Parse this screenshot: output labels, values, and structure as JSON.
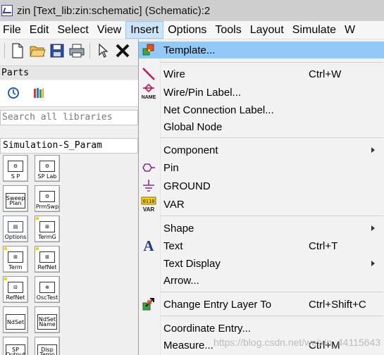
{
  "window": {
    "title": "zin [Text_lib:zin:schematic] (Schematic):2"
  },
  "menubar": {
    "items": [
      "File",
      "Edit",
      "Select",
      "View",
      "Insert",
      "Options",
      "Tools",
      "Layout",
      "Simulate",
      "W"
    ],
    "active": "Insert"
  },
  "toolbar": {
    "icons": [
      "new-document-icon",
      "open-folder-icon",
      "save-icon",
      "print-icon",
      "pointer-icon",
      "delete-x-icon"
    ]
  },
  "parts": {
    "header": "Parts",
    "search_placeholder": "Search all libraries",
    "library": "Simulation-S_Param",
    "palette": [
      {
        "top": "",
        "label": "S P"
      },
      {
        "top": "",
        "label": "SP Lab"
      },
      {
        "top": "Sweep Plan",
        "label": ""
      },
      {
        "top": "",
        "label": "PrmSwp"
      },
      {
        "top": "",
        "label": "Options"
      },
      {
        "top": "",
        "label": "TermG"
      },
      {
        "top": "",
        "label": "Term"
      },
      {
        "top": "",
        "label": "RefNet"
      },
      {
        "top": "",
        "label": "RefNet"
      },
      {
        "top": "",
        "label": "OscTest"
      },
      {
        "top": "NdSet",
        "label": ""
      },
      {
        "top": "NdSet Name",
        "label": ""
      },
      {
        "top": "SP Output",
        "label": ""
      },
      {
        "top": "Disp Temp",
        "label": ""
      }
    ]
  },
  "insert_menu": {
    "items": [
      {
        "label": "Template...",
        "shortcut": "",
        "icon": "template-icon",
        "submenu": false
      },
      {
        "label": "Wire",
        "shortcut": "Ctrl+W",
        "icon": "wire-icon",
        "submenu": false
      },
      {
        "label": "Wire/Pin Label...",
        "shortcut": "",
        "icon": "name-label-icon",
        "submenu": false
      },
      {
        "label": "Net Connection Label...",
        "shortcut": "",
        "icon": "",
        "submenu": false
      },
      {
        "label": "Global Node",
        "shortcut": "",
        "icon": "",
        "submenu": false
      },
      {
        "label": "Component",
        "shortcut": "",
        "icon": "",
        "submenu": true
      },
      {
        "label": "Pin",
        "shortcut": "",
        "icon": "pin-icon",
        "submenu": false
      },
      {
        "label": "GROUND",
        "shortcut": "",
        "icon": "ground-icon",
        "submenu": false
      },
      {
        "label": "VAR",
        "shortcut": "",
        "icon": "var-icon",
        "submenu": false
      },
      {
        "label": "Shape",
        "shortcut": "",
        "icon": "",
        "submenu": true
      },
      {
        "label": "Text",
        "shortcut": "Ctrl+T",
        "icon": "text-icon",
        "submenu": false
      },
      {
        "label": "Text Display",
        "shortcut": "",
        "icon": "",
        "submenu": true
      },
      {
        "label": "Arrow...",
        "shortcut": "",
        "icon": "",
        "submenu": false
      },
      {
        "label": "Change Entry Layer To",
        "shortcut": "Ctrl+Shift+C",
        "icon": "change-layer-icon",
        "submenu": false
      },
      {
        "label": "Coordinate Entry...",
        "shortcut": "",
        "icon": "",
        "submenu": false
      },
      {
        "label": "Measure...",
        "shortcut": "Ctrl+M",
        "icon": "",
        "submenu": false
      }
    ],
    "icon_labels": {
      "name": "NAME",
      "var_bits": "0110",
      "var_text": "VAR"
    }
  },
  "watermark": "https://blog.csdn.net/weixin_44115643",
  "colors": {
    "highlight": "#91c9f7",
    "menu_active": "#cce4f7",
    "wire_icon": "#c0145a",
    "pin_icon": "#8b2a8b",
    "ground_icon": "#8b2a8b"
  }
}
